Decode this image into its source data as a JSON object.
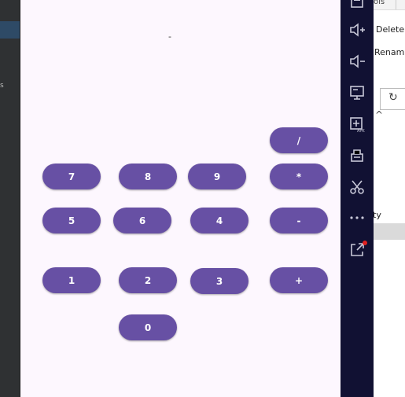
{
  "calculator": {
    "display": "-",
    "keys": {
      "divide": "/",
      "seven": "7",
      "eight": "8",
      "nine": "9",
      "multiply": "*",
      "five": "5",
      "six": "6",
      "four": "4",
      "minus": "-",
      "one": "1",
      "two": "2",
      "three": "3",
      "plus": "+",
      "zero": "0"
    },
    "accent": "#6750a4"
  },
  "ide": {
    "top_tab": "ols",
    "delete": "Delete",
    "rename": "Renam",
    "fragment": "ty"
  },
  "toolbar": {
    "icons": [
      "screenshot-icon",
      "volume-up-icon",
      "volume-down-icon",
      "display-icon",
      "install-apk-icon",
      "print-icon",
      "cut-icon",
      "more-icon",
      "share-icon"
    ]
  }
}
